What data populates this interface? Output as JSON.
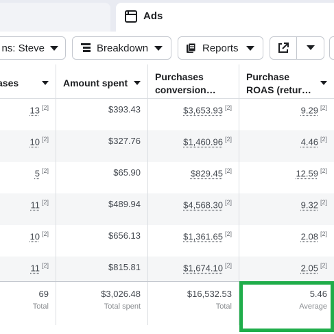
{
  "tabs": {
    "active_label": "Ads"
  },
  "toolbar": {
    "campaigns_label": "ns: Steve",
    "breakdown_label": "Breakdown",
    "reports_label": "Reports"
  },
  "table": {
    "headers": {
      "purchases": "ases",
      "amount_spent": "Amount spent",
      "conversion_line1": "Purchases",
      "conversion_line2": "conversion…",
      "roas_line1": "Purchase",
      "roas_line2": "ROAS (retur…"
    },
    "rows": [
      {
        "purchases": "13",
        "amount_spent": "$393.43",
        "conversion": "$3,653.93",
        "roas": "9.29",
        "fn": "[2]"
      },
      {
        "purchases": "10",
        "amount_spent": "$327.76",
        "conversion": "$1,460.96",
        "roas": "4.46",
        "fn": "[2]"
      },
      {
        "purchases": "5",
        "amount_spent": "$65.90",
        "conversion": "$829.45",
        "roas": "12.59",
        "fn": "[2]"
      },
      {
        "purchases": "11",
        "amount_spent": "$489.94",
        "conversion": "$4,568.30",
        "roas": "9.32",
        "fn": "[2]"
      },
      {
        "purchases": "10",
        "amount_spent": "$656.13",
        "conversion": "$1,361.65",
        "roas": "2.08",
        "fn": "[2]"
      },
      {
        "purchases": "11",
        "amount_spent": "$815.81",
        "conversion": "$1,674.10",
        "roas": "2.05",
        "fn": "[2]"
      }
    ],
    "totals": {
      "purchases": "69",
      "purchases_label": "Total",
      "amount_spent": "$3,026.48",
      "amount_spent_label": "Total spent",
      "conversion": "$16,532.53",
      "conversion_label": "Total",
      "roas": "5.46",
      "roas_label": "Average"
    }
  },
  "colors": {
    "highlight": "#1fad4a",
    "alt_row": "#f5f6f7",
    "tab_bar": "#e9ebf2"
  }
}
